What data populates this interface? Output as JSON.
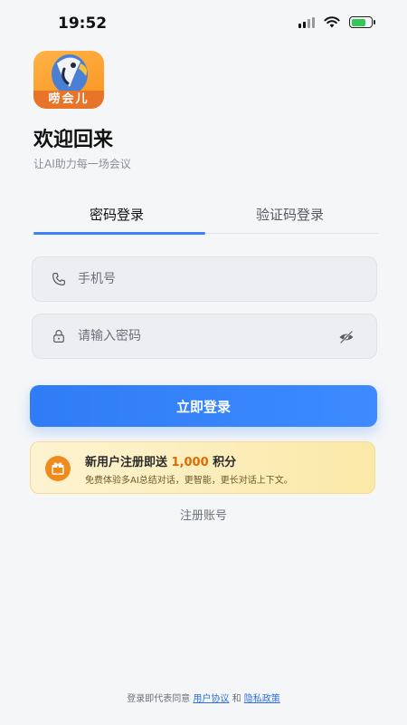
{
  "status_bar": {
    "time": "19:52"
  },
  "logo": {
    "text": "唠会儿"
  },
  "header": {
    "title": "欢迎回来",
    "subtitle": "让AI助力每一场会议"
  },
  "tabs": [
    {
      "label": "密码登录",
      "active": true
    },
    {
      "label": "验证码登录",
      "active": false
    }
  ],
  "form": {
    "phone_placeholder": "手机号",
    "password_placeholder": "请输入密码",
    "login_label": "立即登录"
  },
  "promo": {
    "title_prefix": "新用户注册即送 ",
    "title_points": "1,000",
    "title_suffix": " 积分",
    "subtitle": "免费体验多AI总结对话，更智能，更长对话上下文。"
  },
  "register_label": "注册账号",
  "agreement": {
    "prefix": "登录即代表同意 ",
    "user_agreement": "用户协议",
    "and": " 和 ",
    "privacy_policy": "隐私政策"
  },
  "colors": {
    "accent": "#2f7cf6",
    "promo_highlight": "#e06a00",
    "logo_orange": "#f7931e"
  }
}
